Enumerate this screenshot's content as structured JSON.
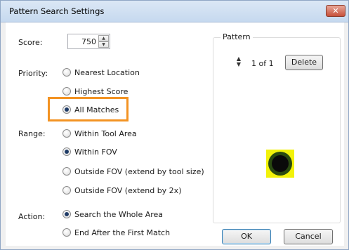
{
  "window": {
    "title": "Pattern Search Settings",
    "close_glyph": "✕"
  },
  "score": {
    "label": "Score:",
    "value": "750",
    "up": "▲",
    "down": "▼"
  },
  "priority": {
    "label": "Priority:",
    "options": [
      {
        "label": "Nearest Location",
        "selected": false
      },
      {
        "label": "Highest Score",
        "selected": false
      },
      {
        "label": "All Matches",
        "selected": true
      }
    ]
  },
  "range": {
    "label": "Range:",
    "options": [
      {
        "label": "Within Tool Area",
        "selected": false
      },
      {
        "label": "Within FOV",
        "selected": true
      },
      {
        "label": "Outside FOV (extend by tool size)",
        "selected": false
      },
      {
        "label": "Outside FOV (extend by 2x)",
        "selected": false
      }
    ]
  },
  "action": {
    "label": "Action:",
    "options": [
      {
        "label": "Search the Whole Area",
        "selected": true
      },
      {
        "label": "End After the First Match",
        "selected": false
      }
    ]
  },
  "pattern": {
    "title": "Pattern",
    "count": "1 of 1",
    "delete_label": "Delete",
    "spin_up": "▲",
    "spin_down": "▼"
  },
  "buttons": {
    "ok": "OK",
    "cancel": "Cancel"
  },
  "colors": {
    "highlight": "#f39323",
    "pattern_yellow": "#f2f20a"
  }
}
